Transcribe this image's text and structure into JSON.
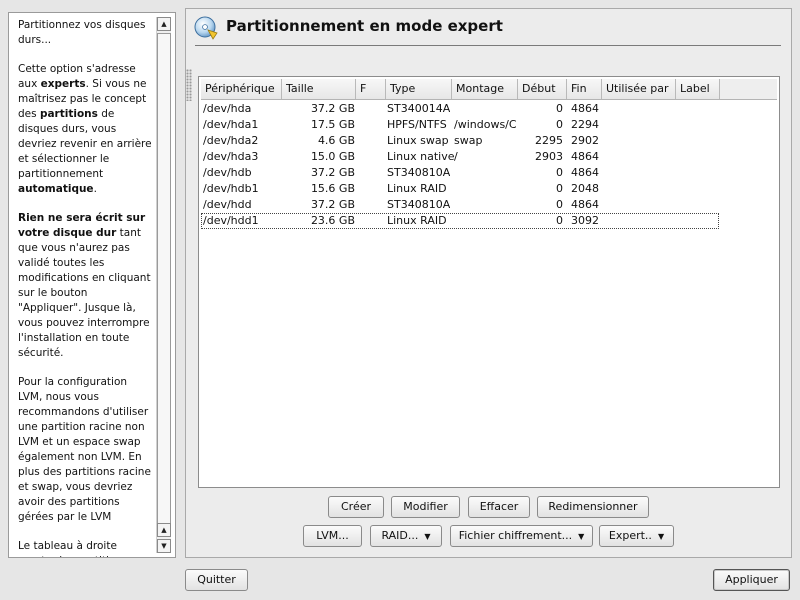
{
  "help": {
    "p1": "Partitionnez vos disques durs...",
    "p2_a": "Cette option s'adresse aux ",
    "p2_b": "experts",
    "p2_c": ". Si vous ne maîtrisez pas le concept des ",
    "p2_d": "partitions",
    "p2_e": " de disques durs, vous devriez revenir en arrière et sélectionner le partitionnement ",
    "p2_f": "automatique",
    "p2_g": ".",
    "p3_a": "Rien ne sera écrit sur votre disque dur",
    "p3_b": " tant que vous n'aurez pas validé toutes les modifications en cliquant sur le bouton \"Appliquer\". Jusque là, vous pouvez interrompre l'installation en toute sécurité.",
    "p4": "Pour la configuration LVM, nous vous recommandons d'utiliser une partition racine non LVM et un espace swap également non LVM. En plus des partitions racine et swap, vous devriez avoir des partitions gérées par le LVM",
    "p5": "Le tableau à droite montre les partitions"
  },
  "main": {
    "title": "Partitionnement en mode expert",
    "icon": "disk-partition-icon"
  },
  "table": {
    "columns": [
      "Périphérique",
      "Taille",
      "F",
      "Type",
      "Montage",
      "Début",
      "Fin",
      "Utilisée par",
      "Label"
    ],
    "rows": [
      [
        "/dev/hda",
        "37.2 GB",
        "",
        "ST340014A",
        "",
        "0",
        "4864",
        "",
        ""
      ],
      [
        "/dev/hda1",
        "17.5 GB",
        "",
        "HPFS/NTFS",
        "/windows/C",
        "0",
        "2294",
        "",
        ""
      ],
      [
        "/dev/hda2",
        "4.6 GB",
        "",
        "Linux swap",
        "swap",
        "2295",
        "2902",
        "",
        ""
      ],
      [
        "/dev/hda3",
        "15.0 GB",
        "",
        "Linux native",
        "/",
        "2903",
        "4864",
        "",
        ""
      ],
      [
        "/dev/hdb",
        "37.2 GB",
        "",
        "ST340810A",
        "",
        "0",
        "4864",
        "",
        ""
      ],
      [
        "/dev/hdb1",
        "15.6 GB",
        "",
        "Linux RAID",
        "",
        "0",
        "2048",
        "",
        ""
      ],
      [
        "/dev/hdd",
        "37.2 GB",
        "",
        "ST340810A",
        "",
        "0",
        "4864",
        "",
        ""
      ],
      [
        "/dev/hdd1",
        "23.6 GB",
        "",
        "Linux RAID",
        "",
        "0",
        "3092",
        "",
        ""
      ]
    ],
    "focused_row": "/dev/hdd1"
  },
  "buttons": {
    "create": "Créer",
    "modify": "Modifier",
    "delete": "Effacer",
    "resize": "Redimensionner",
    "lvm": "LVM...",
    "raid": "RAID...",
    "crypt": "Fichier chiffrement...",
    "expert": "Expert..",
    "quit": "Quitter",
    "apply": "Appliquer"
  },
  "colors": {
    "background": "#e6e6e6",
    "panel": "#ececec",
    "table_bg": "#ffffff"
  }
}
